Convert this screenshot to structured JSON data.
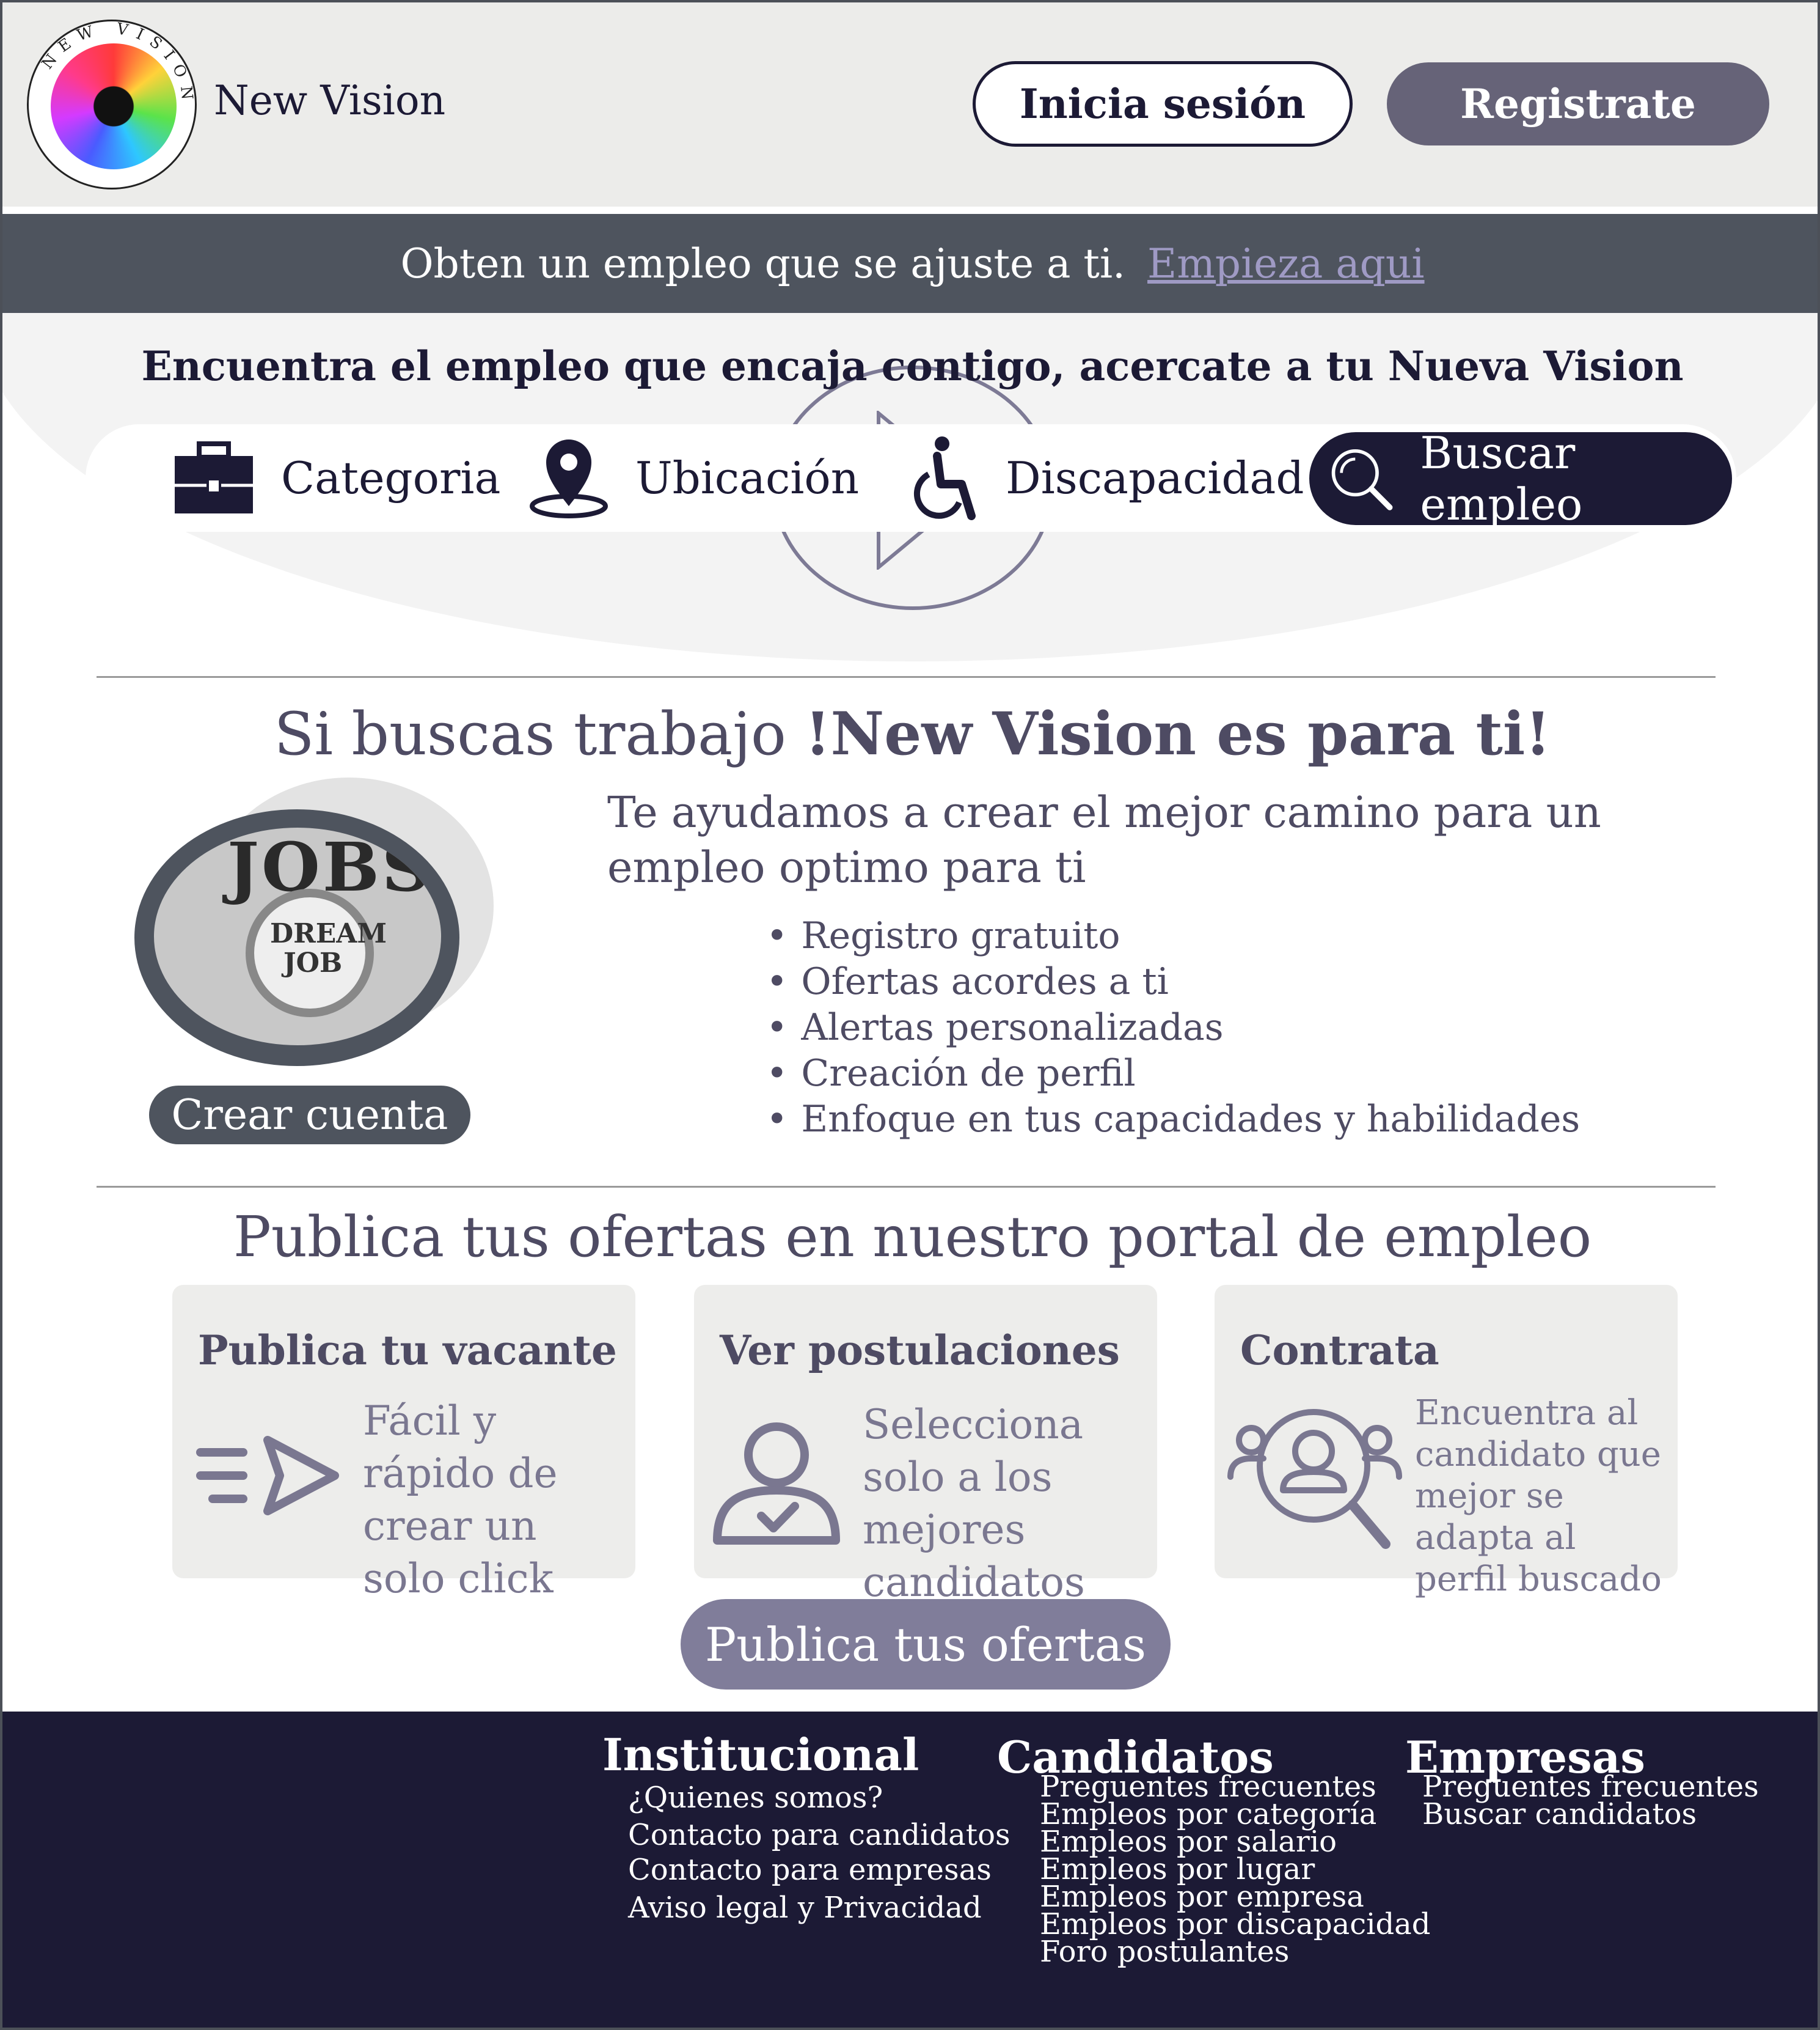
{
  "header": {
    "logo_text": "NEW VISION",
    "brand": "New Vision",
    "login_label": "Inicia sesión",
    "register_label": "Registrate"
  },
  "banner": {
    "text": "Obten un empleo que se ajuste a ti.",
    "link": "Empieza aqui"
  },
  "hero": {
    "title": "Encuentra el empleo que encaja contigo, acercate a tu Nueva Vision",
    "search": {
      "category": "Categoria",
      "location": "Ubicación",
      "disability": "Discapacidad",
      "button": "Buscar empleo"
    }
  },
  "section1": {
    "title_plain": "Si buscas trabajo ",
    "title_bold": "!New Vision es para ti!",
    "image_word": "JOBS",
    "image_word2": "DREAM JOB",
    "create_account": "Crear cuenta",
    "description": "Te ayudamos a crear el mejor camino para un empleo optimo para ti",
    "benefits": [
      "Registro gratuito",
      "Ofertas acordes a ti",
      "Alertas personalizadas",
      "Creación de perfil",
      "Enfoque en tus capacidades y habilidades"
    ]
  },
  "section2": {
    "title": "Publica tus ofertas en nuestro portal de empleo",
    "cards": [
      {
        "title": "Publica tu vacante",
        "text": "Fácil y rápido de crear un solo click",
        "icon": "send-icon"
      },
      {
        "title": "Ver postulaciones",
        "text": "Selecciona solo a los mejores candidatos",
        "icon": "user-check-icon"
      },
      {
        "title": "Contrata",
        "text": "Encuentra al candidato que mejor se adapta al perfil buscado",
        "icon": "people-search-icon"
      }
    ],
    "button": "Publica tus ofertas"
  },
  "footer": {
    "columns": [
      {
        "heading": "Institucional",
        "items": [
          "¿Quienes somos?",
          "Contacto para candidatos",
          "Contacto para  empresas",
          "Aviso legal y Privacidad"
        ]
      },
      {
        "heading": "Candidatos",
        "items": [
          "Preguentes frecuentes",
          "Empleos por categoría",
          "Empleos por salario",
          "Empleos por lugar",
          "Empleos por empresa",
          "Empleos por discapacidad",
          "Foro postulantes"
        ]
      },
      {
        "heading": "Empresas",
        "items": [
          "Preguentes frecuentes",
          "Buscar candidatos"
        ]
      }
    ]
  },
  "colors": {
    "navy": "#1c1a35",
    "slate": "#4e545e",
    "purple_gray": "#666378",
    "link_lavender": "#9f9ac4",
    "card_bg": "#ededeb"
  }
}
